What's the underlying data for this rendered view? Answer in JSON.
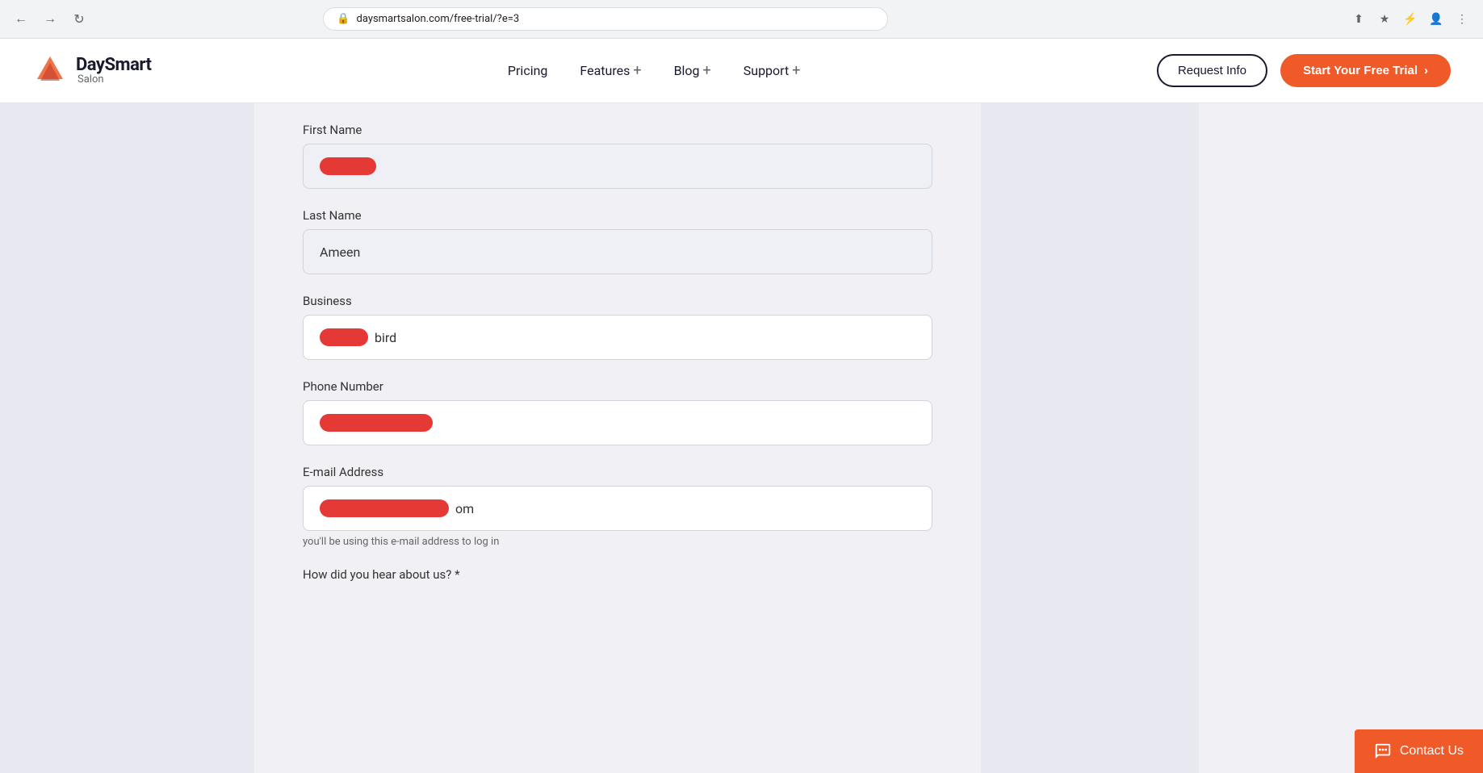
{
  "browser": {
    "url": "daysmartsalon.com/free-trial/?e=3"
  },
  "header": {
    "logo_main": "DaySmart",
    "logo_sub": "Salon",
    "nav_items": [
      {
        "label": "Pricing",
        "has_plus": false
      },
      {
        "label": "Features",
        "has_plus": true
      },
      {
        "label": "Blog",
        "has_plus": true
      },
      {
        "label": "Support",
        "has_plus": true
      }
    ],
    "btn_request_info": "Request Info",
    "btn_free_trial": "Start Your Free Trial"
  },
  "form": {
    "first_name_label": "First Name",
    "first_name_value": "[REDACTED]",
    "last_name_label": "Last Name",
    "last_name_value": "Ameen",
    "business_label": "Business",
    "business_suffix": "bird",
    "phone_label": "Phone Number",
    "email_label": "E-mail Address",
    "email_suffix": "om",
    "email_hint": "you'll be using this e-mail address to log in",
    "how_hear_label": "How did you hear about us? *"
  },
  "contact_us": {
    "label": "Contact Us"
  }
}
